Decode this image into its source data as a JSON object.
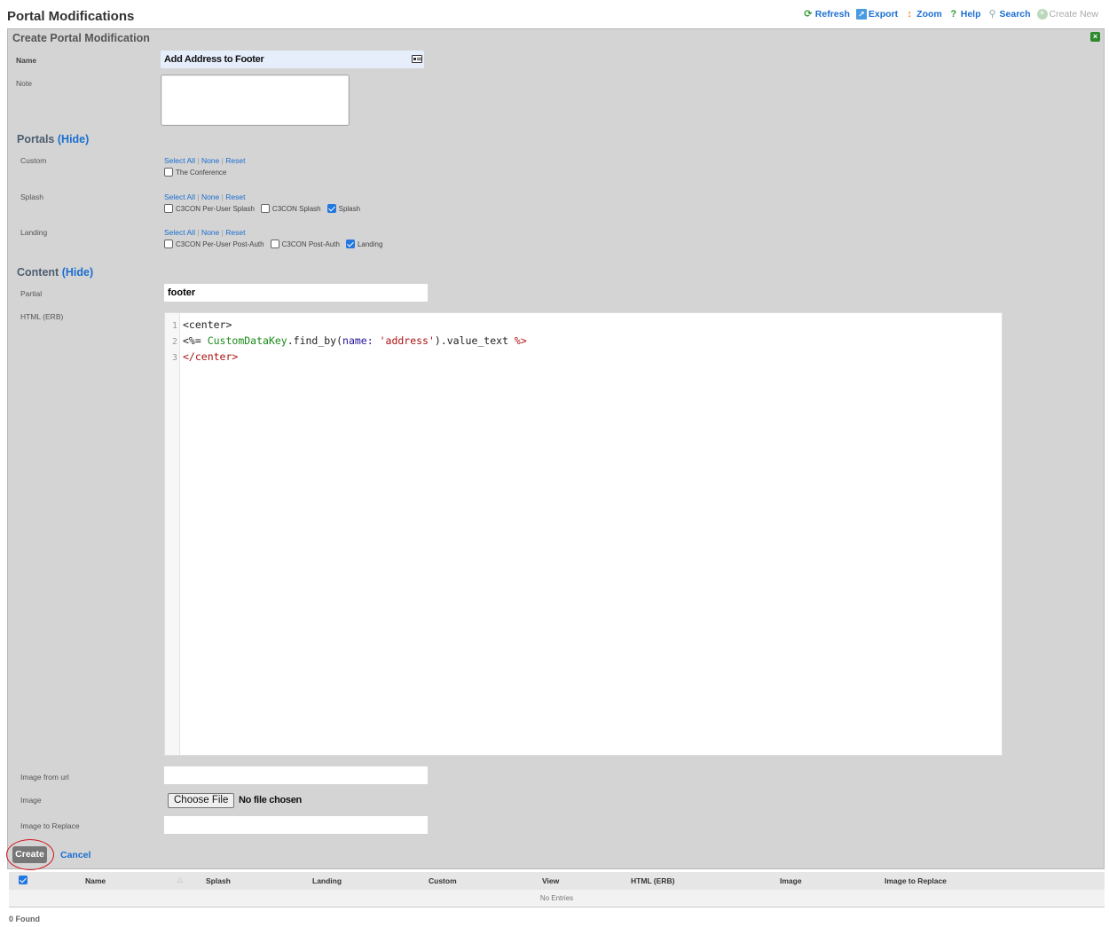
{
  "page_title": "Portal Modifications",
  "toolbar": {
    "refresh": "Refresh",
    "export": "Export",
    "zoom": "Zoom",
    "help": "Help",
    "search": "Search",
    "create_new": "Create New"
  },
  "form": {
    "header": "Create Portal Modification",
    "name_label": "Name",
    "name_value": "Add Address to Footer",
    "note_label": "Note",
    "note_value": "",
    "portals_section": {
      "title": "Portals",
      "hide_label": "(Hide)"
    },
    "select_all": "Select All",
    "none": "None",
    "reset": "Reset",
    "sep": "|",
    "custom": {
      "label": "Custom",
      "options": [
        {
          "label": "The Conference",
          "checked": false
        }
      ]
    },
    "splash": {
      "label": "Splash",
      "options": [
        {
          "label": "C3CON Per-User Splash",
          "checked": false
        },
        {
          "label": "C3CON Splash",
          "checked": false
        },
        {
          "label": "Splash",
          "checked": true
        }
      ]
    },
    "landing": {
      "label": "Landing",
      "options": [
        {
          "label": "C3CON Per-User Post-Auth",
          "checked": false
        },
        {
          "label": "C3CON Post-Auth",
          "checked": false
        },
        {
          "label": "Landing",
          "checked": true
        }
      ]
    },
    "content_section": {
      "title": "Content",
      "hide_label": "(Hide)"
    },
    "partial_label": "Partial",
    "partial_value": "footer",
    "html_label": "HTML (ERB)",
    "code_lines": [
      {
        "num": "1",
        "tokens": [
          {
            "t": "<center>",
            "c": "tok-tag"
          }
        ]
      },
      {
        "num": "2",
        "tokens": [
          {
            "t": "<%= ",
            "c": "tok-erb"
          },
          {
            "t": "CustomDataKey",
            "c": "tok-class"
          },
          {
            "t": ".find_by(",
            "c": "tok-plain"
          },
          {
            "t": "name:",
            "c": "tok-sym"
          },
          {
            "t": " ",
            "c": "tok-plain"
          },
          {
            "t": "'address'",
            "c": "tok-str"
          },
          {
            "t": ").value_text ",
            "c": "tok-plain"
          },
          {
            "t": "%>",
            "c": "tok-erbend"
          }
        ]
      },
      {
        "num": "3",
        "tokens": [
          {
            "t": "</center>",
            "c": "tok-tagend"
          }
        ]
      }
    ],
    "image_url_label": "Image from url",
    "image_url_value": "",
    "image_label": "Image",
    "choose_file": "Choose File",
    "no_file": "No file chosen",
    "image_replace_label": "Image to Replace",
    "image_replace_value": "",
    "create_button": "Create",
    "cancel_link": "Cancel"
  },
  "table": {
    "columns": [
      "Name",
      "Splash",
      "Landing",
      "Custom",
      "View",
      "HTML (ERB)",
      "Image",
      "Image to Replace"
    ],
    "select_all_checked": true,
    "empty_text": "No Entries",
    "found_text": "0 Found"
  }
}
